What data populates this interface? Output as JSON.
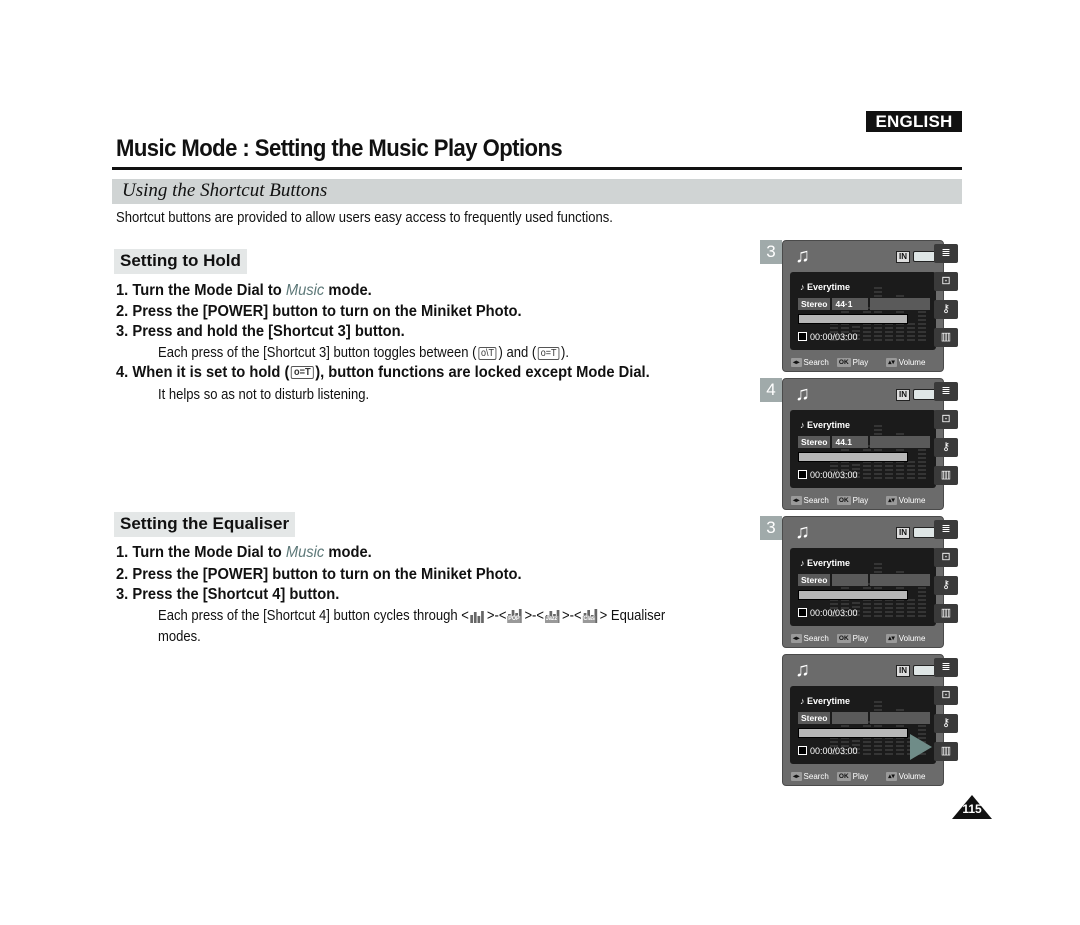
{
  "header": {
    "language_badge": "ENGLISH",
    "page_title": "Music Mode : Setting the Music Play Options"
  },
  "section": {
    "title": "Using the Shortcut Buttons",
    "intro": "Shortcut buttons are provided to allow users easy access to frequently used functions."
  },
  "hold": {
    "heading": "Setting to Hold",
    "steps": [
      {
        "num": "1.",
        "pre": "Turn the Mode Dial to ",
        "em": "Music",
        "post": " mode."
      },
      {
        "num": "2.",
        "text": "Press the [POWER] button to turn on the Miniket Photo."
      },
      {
        "num": "3.",
        "text": "Press and hold the [Shortcut 3] button."
      },
      {
        "num": "4.",
        "pre": "When it is set to hold (",
        "icon": "hold-on-icon",
        "post": "), button functions are locked except Mode Dial."
      }
    ],
    "note3_pre": "Each press of the [Shortcut 3] button toggles between (",
    "note3_mid": ") and (",
    "note3_post": ").",
    "note4": "It helps so as not to disturb listening.",
    "icon_off_label": "o\\T",
    "icon_on_label": "o=T"
  },
  "equaliser": {
    "heading": "Setting the Equaliser",
    "steps": [
      {
        "num": "1.",
        "pre": "Turn the Mode Dial to ",
        "em": "Music",
        "post": " mode."
      },
      {
        "num": "2.",
        "text": "Press the [POWER] button to turn on the Miniket Photo."
      },
      {
        "num": "3.",
        "text": "Press the [Shortcut 4] button."
      }
    ],
    "note_pre": "Each press of the [Shortcut 4] button cycles through",
    "note_post": "Equaliser",
    "note_line2": "modes.",
    "modes": [
      "Normal",
      "POP",
      "Jazz",
      "Clas"
    ]
  },
  "screens": [
    {
      "step": "3",
      "song": "Everytime",
      "mode": "Stereo",
      "rate": "44·1",
      "time": "00:00/03:00",
      "storage": "IN"
    },
    {
      "step": "4",
      "song": "Everytime",
      "mode": "Stereo",
      "rate": "44.1",
      "time": "00:00/03:00",
      "storage": "IN"
    },
    {
      "step": "3",
      "song": "Everytime",
      "mode": "Stereo",
      "rate": "",
      "time": "00:00/03:00",
      "storage": "IN"
    },
    {
      "step": "",
      "song": "Everytime",
      "mode": "Stereo",
      "rate": "",
      "time": "00:00/03:00",
      "storage": "IN"
    }
  ],
  "screen_controls": {
    "search_key": "◂▸",
    "search_label": "Search",
    "play_key": "OK",
    "play_label": "Play",
    "volume_key": "▴▾",
    "volume_label": "Volume"
  },
  "side_icons": [
    "menu-icon",
    "repeat-off-icon",
    "hold-icon",
    "equaliser-icon"
  ],
  "page_number": "115"
}
